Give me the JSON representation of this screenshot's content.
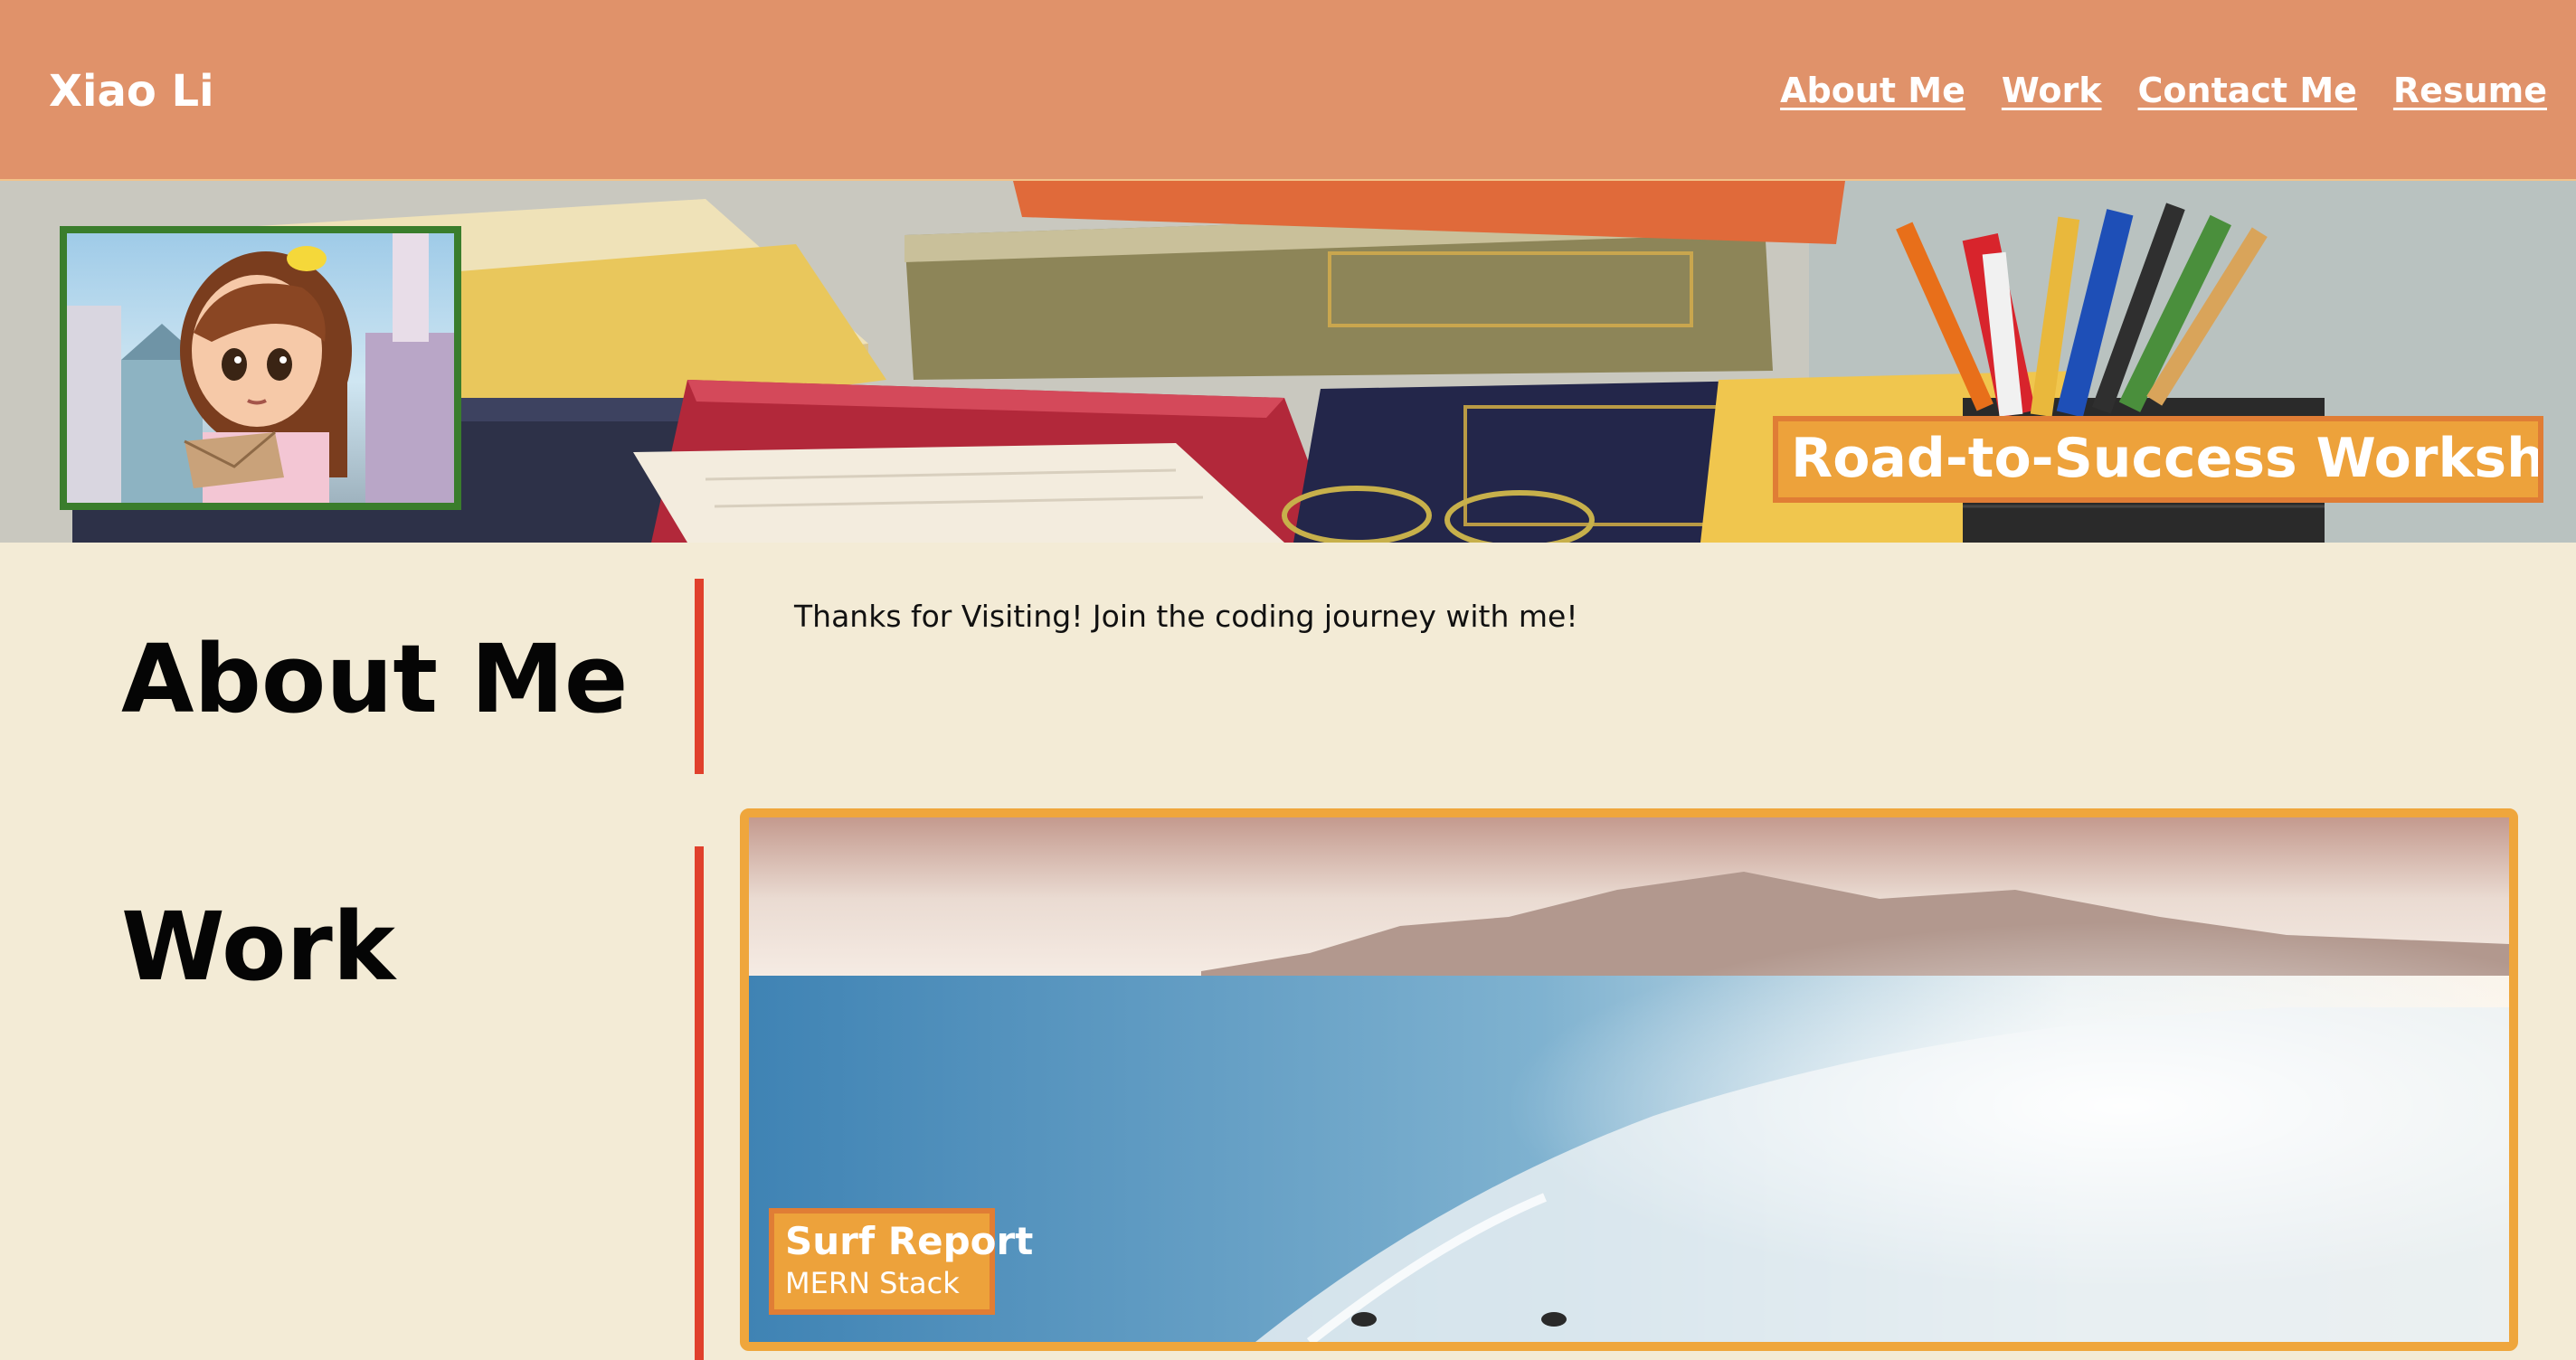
{
  "header": {
    "brand": "Xiao Li",
    "nav": [
      {
        "label": "About Me"
      },
      {
        "label": "Work"
      },
      {
        "label": "Contact Me"
      },
      {
        "label": "Resume"
      }
    ]
  },
  "hero": {
    "title": "Road-to-Success Workshop"
  },
  "about": {
    "heading": "About Me",
    "text": "Thanks for Visiting! Join the coding journey with me!"
  },
  "work": {
    "heading": "Work",
    "projects": [
      {
        "title": "Surf Report",
        "subtitle": "MERN Stack"
      }
    ]
  },
  "colors": {
    "header_bg": "#e0926a",
    "page_bg": "#f3ebd6",
    "accent_orange": "#eda23b",
    "divider_red": "#e0402c",
    "avatar_border": "#3a7d2c"
  }
}
